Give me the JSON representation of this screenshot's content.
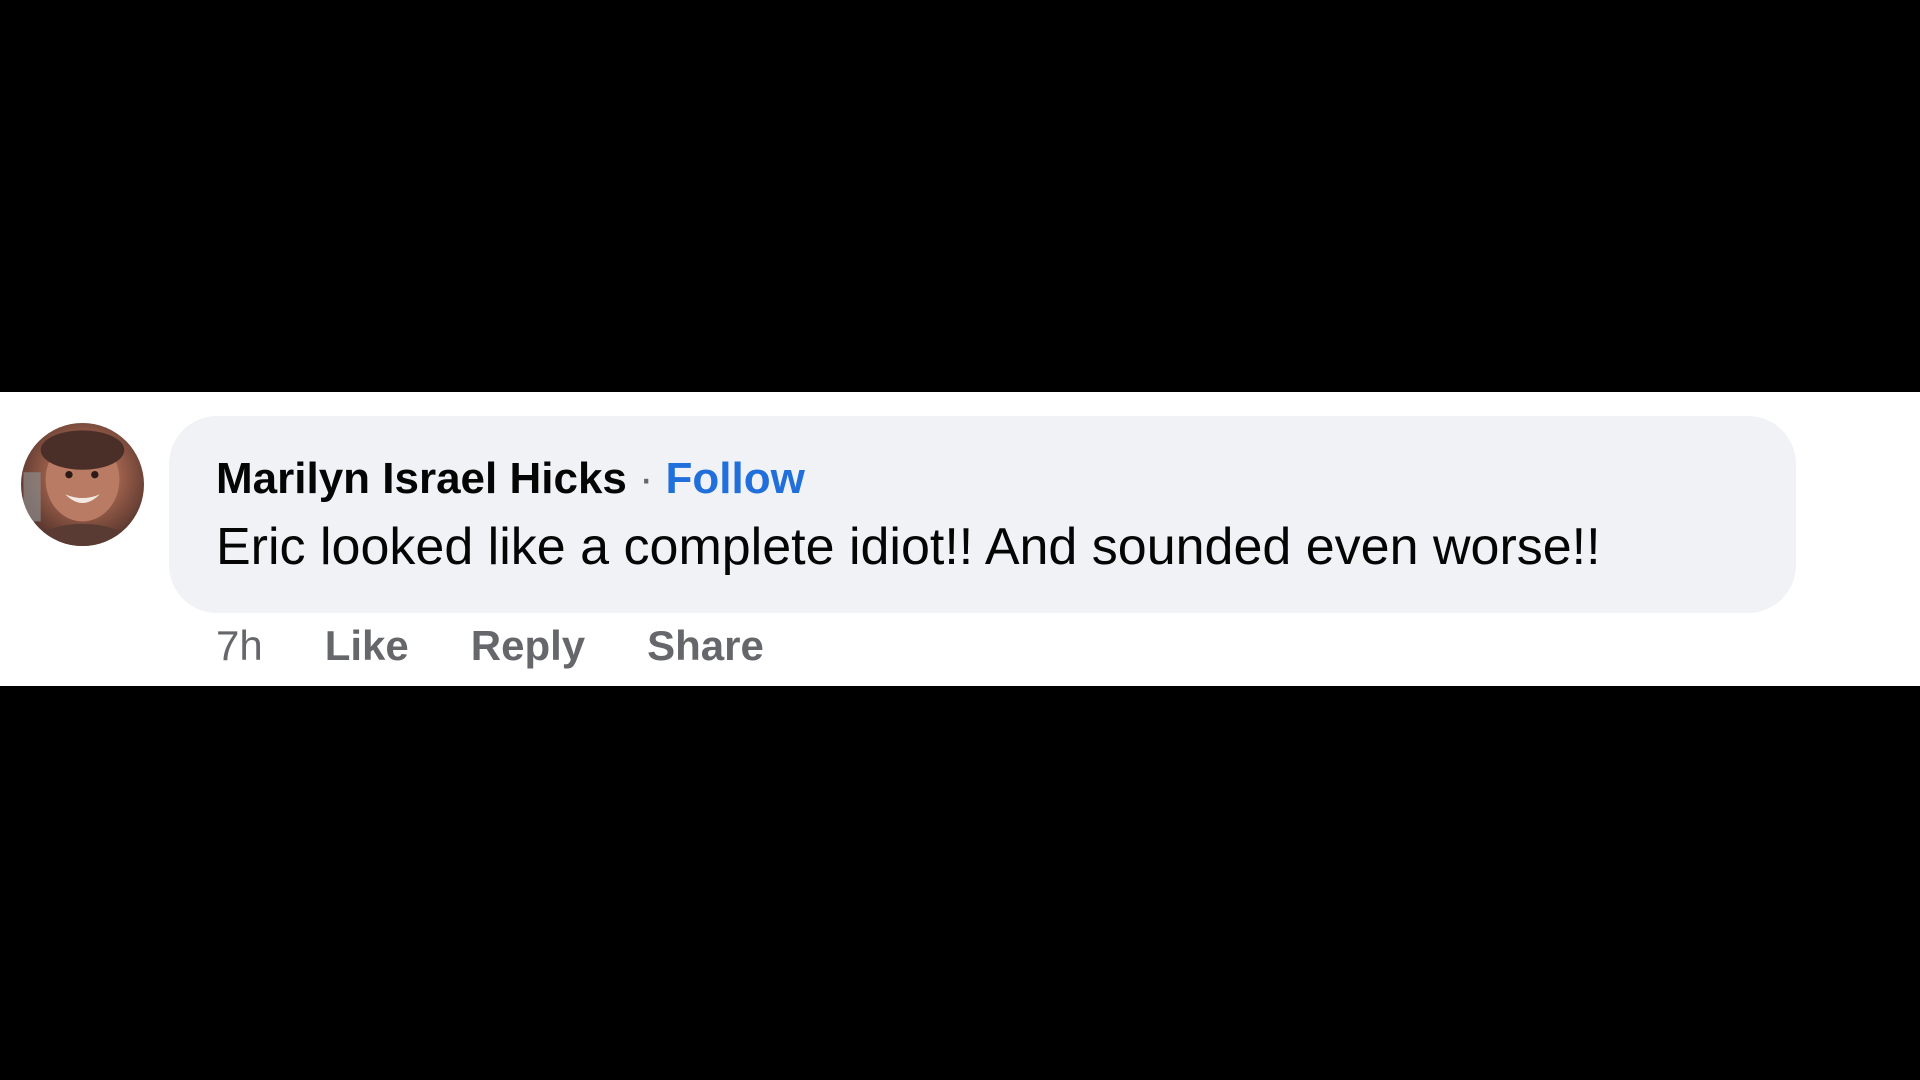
{
  "comment": {
    "author": "Marilyn Israel Hicks",
    "separator": "·",
    "follow_label": "Follow",
    "text": "Eric looked like a complete idiot!! And sounded even worse!!",
    "timestamp": "7h",
    "like_label": "Like",
    "reply_label": "Reply",
    "share_label": "Share"
  },
  "colors": {
    "bubble_bg": "#f0f2f5",
    "follow_link": "#216fdb",
    "meta_text": "#65676b",
    "primary_text": "#050505",
    "letterbox": "#000000"
  },
  "icons": {
    "avatar": "user-avatar-photo"
  }
}
